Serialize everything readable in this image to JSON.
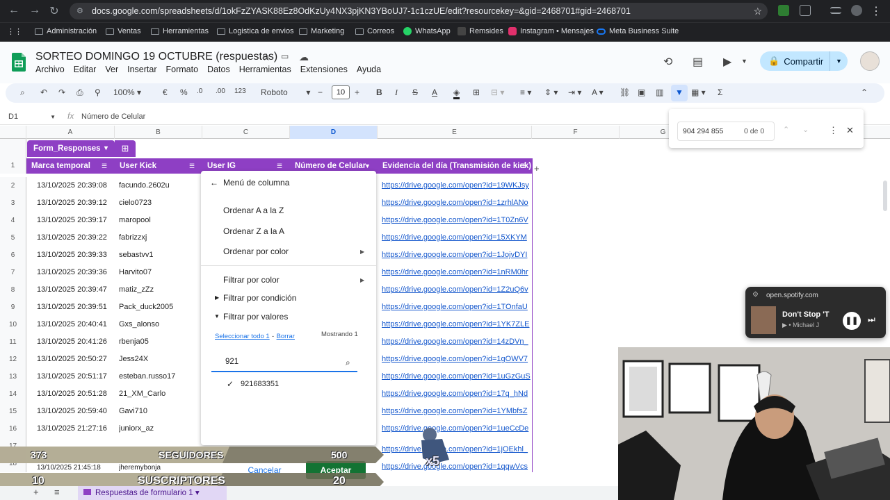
{
  "browser": {
    "url": "docs.google.com/spreadsheets/d/1okFzZYASK88Ez8OdKzUy4NX3pjKN3YBoUJ7-1c1czUE/edit?resourcekey=&gid=2468701#gid=2468701"
  },
  "bookmarks": [
    "Administración",
    "Ventas",
    "Herramientas",
    "Logistica de envios",
    "Marketing",
    "Correos",
    "WhatsApp",
    "Remsides",
    "Instagram • Mensajes",
    "Meta Business Suite"
  ],
  "doc": {
    "title": "SORTEO DOMINGO 19 OCTUBRE (respuestas)",
    "share_label": "Compartir"
  },
  "menus": [
    "Archivo",
    "Editar",
    "Ver",
    "Insertar",
    "Formato",
    "Datos",
    "Herramientas",
    "Extensiones",
    "Ayuda"
  ],
  "toolbar": {
    "zoom": "100%",
    "currency": "€",
    "percent": "%",
    "dec_minus": ".0",
    "dec_plus": ".00",
    "format_123": "123",
    "font": "Roboto",
    "font_size": "10",
    "minus": "−",
    "plus": "+",
    "bold": "B",
    "italic": "I",
    "strike": "S",
    "text_color": "A"
  },
  "formula": {
    "cell_ref": "D1",
    "content": "Número de Celular",
    "fx": "fx"
  },
  "columns": [
    "A",
    "B",
    "C",
    "D",
    "E",
    "F",
    "G"
  ],
  "table": {
    "name": "Form_Responses",
    "headers": [
      "Marca temporal",
      "User Kick",
      "User IG",
      "Número de Celular",
      "Evidencia del día (Transmisión de kick)"
    ],
    "rows": [
      {
        "n": "2",
        "ts": "13/10/2025 20:39:08",
        "user": "facundo.2602u",
        "link": "https://drive.google.com/open?id=19WKJsy"
      },
      {
        "n": "3",
        "ts": "13/10/2025 20:39:12",
        "user": "cielo0723",
        "link": "https://drive.google.com/open?id=1zrhlANo"
      },
      {
        "n": "4",
        "ts": "13/10/2025 20:39:17",
        "user": "maropool",
        "link": "https://drive.google.com/open?id=1T0Zn6V"
      },
      {
        "n": "5",
        "ts": "13/10/2025 20:39:22",
        "user": "fabrizzxj",
        "link": "https://drive.google.com/open?id=15XKYM"
      },
      {
        "n": "6",
        "ts": "13/10/2025 20:39:33",
        "user": "sebastvv1",
        "link": "https://drive.google.com/open?id=1JojvDYI"
      },
      {
        "n": "7",
        "ts": "13/10/2025 20:39:36",
        "user": "Harvito07",
        "link": "https://drive.google.com/open?id=1nRM0hr"
      },
      {
        "n": "8",
        "ts": "13/10/2025 20:39:47",
        "user": "matiz_zZz",
        "link": "https://drive.google.com/open?id=1Z2uQ6v"
      },
      {
        "n": "9",
        "ts": "13/10/2025 20:39:51",
        "user": "Pack_duck2005",
        "link": "https://drive.google.com/open?id=1TOnfaU"
      },
      {
        "n": "10",
        "ts": "13/10/2025 20:40:41",
        "user": "Gxs_alonso",
        "link": "https://drive.google.com/open?id=1YK7ZLE"
      },
      {
        "n": "11",
        "ts": "13/10/2025 20:41:26",
        "user": "rbenja05",
        "link": "https://drive.google.com/open?id=14zDVn_"
      },
      {
        "n": "12",
        "ts": "13/10/2025 20:50:27",
        "user": "Jess24X",
        "link": "https://drive.google.com/open?id=1gOWV7"
      },
      {
        "n": "13",
        "ts": "13/10/2025 20:51:17",
        "user": "esteban.russo17",
        "link": "https://drive.google.com/open?id=1uGzGuS"
      },
      {
        "n": "14",
        "ts": "13/10/2025 20:51:28",
        "user": "21_XM_Carlo",
        "link": "https://drive.google.com/open?id=17q_hNd"
      },
      {
        "n": "15",
        "ts": "13/10/2025 20:59:40",
        "user": "Gavi710",
        "link": "https://drive.google.com/open?id=1YMbfsZ"
      },
      {
        "n": "16",
        "ts": "13/10/2025 21:27:16",
        "user": "juniorx_az",
        "link": "https://drive.google.com/open?id=1ueCcDe"
      },
      {
        "n": "17",
        "ts": "",
        "user": "",
        "link": "https://drive.google.com/open?id=1jOEkhl_"
      },
      {
        "n": "18",
        "ts": "13/10/2025 21:45:18",
        "user": "jheremybonja",
        "link": "https://drive.google.com/open?id=1qqwVcs"
      }
    ]
  },
  "column_menu": {
    "title": "Menú de columna",
    "sort_az": "Ordenar A a la Z",
    "sort_za": "Ordenar Z a la A",
    "sort_color": "Ordenar por color",
    "filter_color": "Filtrar por color",
    "filter_condition": "Filtrar por condición",
    "filter_values": "Filtrar por valores",
    "select_all": "Seleccionar todo 1",
    "separator": "-",
    "clear": "Borrar",
    "showing": "Mostrando 1",
    "search_value": "921",
    "value_item": "921683351",
    "cancel": "Cancelar",
    "ok": "Aceptar"
  },
  "find": {
    "query": "904 294 855",
    "count": "0 de 0"
  },
  "spotify": {
    "domain": "open.spotify.com",
    "track": "Don't Stop 'T",
    "artist": "Michael J"
  },
  "stream_overlay": {
    "followers_count": "373",
    "followers_label": "SEGUIDORES",
    "followers_goal": "500",
    "subs_count": "10",
    "subs_label": "SUSCRIPTORES",
    "subs_goal": "20",
    "multiplier": "x5"
  },
  "sheet_tab": {
    "label": "Respuestas de formulario 1"
  }
}
